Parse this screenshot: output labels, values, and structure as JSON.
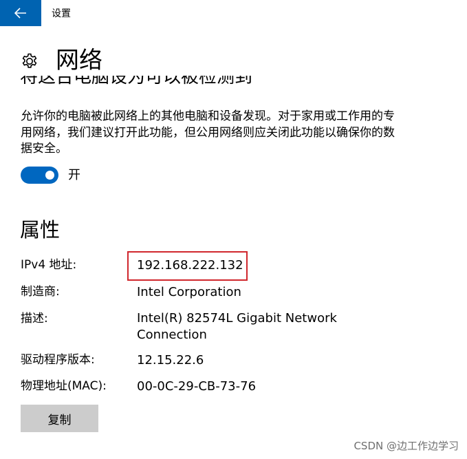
{
  "window": {
    "title": "设置"
  },
  "icons": {
    "back": "back-arrow-icon",
    "gear": "gear-icon"
  },
  "page": {
    "title": "网络"
  },
  "discovery": {
    "heading": "将这台电脑设为可以被检测到",
    "description": "允许你的电脑被此网络上的其他电脑和设备发现。对于家用或工作用的专用网络，我们建议打开此功能，但公用网络则应关闭此功能以确保你的数据安全。",
    "toggle_state": "on",
    "toggle_label": "开"
  },
  "properties": {
    "title": "属性",
    "items": [
      {
        "label": "IPv4 地址:",
        "value": "192.168.222.132"
      },
      {
        "label": "制造商:",
        "value": "Intel Corporation"
      },
      {
        "label": "描述:",
        "value": "Intel(R) 82574L Gigabit Network Connection"
      },
      {
        "label": "驱动程序版本:",
        "value": "12.15.22.6"
      },
      {
        "label": "物理地址(MAC):",
        "value": "00-0C-29-CB-73-76"
      }
    ],
    "copy_label": "复制"
  },
  "watermark": "CSDN @边工作边学习",
  "colors": {
    "accent": "#0063b1",
    "toggle_on": "#0067c0",
    "highlight": "#d0262c",
    "button_bg": "#cccccc"
  }
}
